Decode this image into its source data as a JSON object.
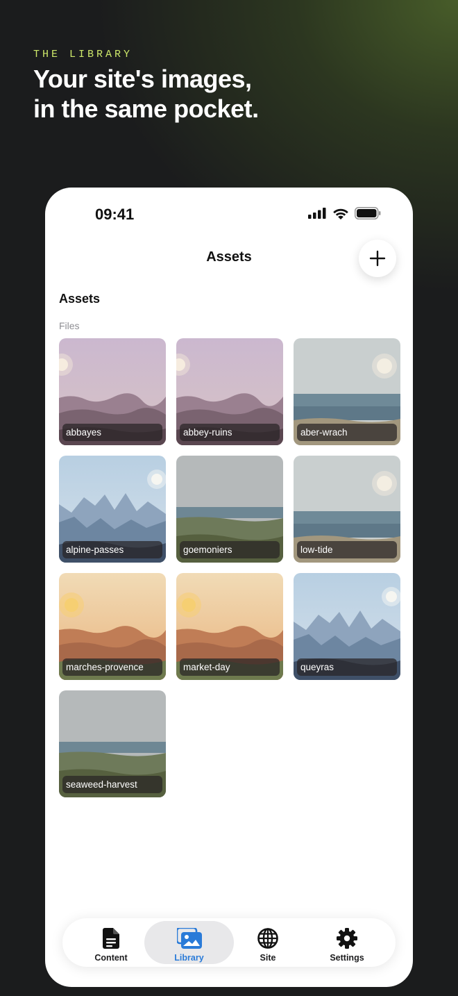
{
  "promo": {
    "eyebrow": "THE LIBRARY",
    "headline_line1": "Your site's images,",
    "headline_line2": "in the same pocket."
  },
  "status_bar": {
    "time": "09:41",
    "icons": [
      "cellular-signal-icon",
      "wifi-icon",
      "battery-icon"
    ]
  },
  "nav": {
    "title": "Assets",
    "add_icon": "plus-icon"
  },
  "section": {
    "title": "Assets",
    "subtitle": "Files"
  },
  "assets": [
    {
      "name": "abbayes",
      "scene": "dusk"
    },
    {
      "name": "abbey-ruins",
      "scene": "dusk"
    },
    {
      "name": "aber-wrach",
      "scene": "coast"
    },
    {
      "name": "alpine-passes",
      "scene": "mountain"
    },
    {
      "name": "goemoniers",
      "scene": "grey"
    },
    {
      "name": "low-tide",
      "scene": "coast"
    },
    {
      "name": "marches-provence",
      "scene": "warm"
    },
    {
      "name": "market-day",
      "scene": "warm"
    },
    {
      "name": "queyras",
      "scene": "mountain"
    },
    {
      "name": "seaweed-harvest",
      "scene": "grey"
    }
  ],
  "tabs": [
    {
      "label": "Content",
      "icon": "document-icon",
      "active": false
    },
    {
      "label": "Library",
      "icon": "photos-icon",
      "active": true
    },
    {
      "label": "Site",
      "icon": "globe-icon",
      "active": false
    },
    {
      "label": "Settings",
      "icon": "gear-icon",
      "active": false
    }
  ],
  "colors": {
    "accent": "#2a7bd8",
    "eyebrow": "#cde86a"
  }
}
